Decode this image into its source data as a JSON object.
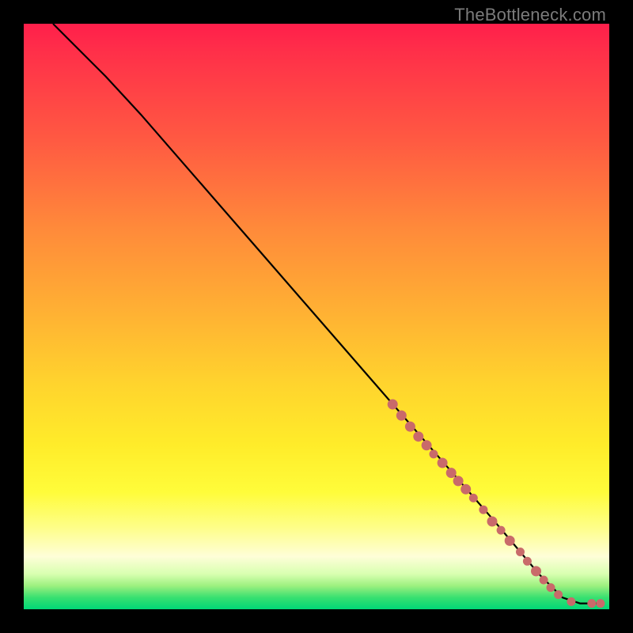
{
  "watermark": "TheBottleneck.com",
  "colors": {
    "curve": "#000000",
    "point_fill": "#c96a6a",
    "point_stroke": "#c96a6a"
  },
  "chart_data": {
    "type": "line",
    "title": "",
    "xlabel": "",
    "ylabel": "",
    "xlim": [
      0,
      100
    ],
    "ylim": [
      0,
      100
    ],
    "curve": [
      {
        "x": 5,
        "y": 100
      },
      {
        "x": 9,
        "y": 96
      },
      {
        "x": 14,
        "y": 91
      },
      {
        "x": 20,
        "y": 84.5
      },
      {
        "x": 30,
        "y": 73
      },
      {
        "x": 40,
        "y": 61.5
      },
      {
        "x": 50,
        "y": 50
      },
      {
        "x": 60,
        "y": 38.5
      },
      {
        "x": 70,
        "y": 27
      },
      {
        "x": 80,
        "y": 15.5
      },
      {
        "x": 88,
        "y": 6
      },
      {
        "x": 92,
        "y": 2
      },
      {
        "x": 95,
        "y": 1
      },
      {
        "x": 98,
        "y": 1
      }
    ],
    "points": [
      {
        "x": 63.0,
        "y": 35.0,
        "r": 6
      },
      {
        "x": 64.5,
        "y": 33.1,
        "r": 6
      },
      {
        "x": 66.0,
        "y": 31.2,
        "r": 6
      },
      {
        "x": 67.4,
        "y": 29.5,
        "r": 6
      },
      {
        "x": 68.8,
        "y": 28.0,
        "r": 6
      },
      {
        "x": 70.0,
        "y": 26.5,
        "r": 5
      },
      {
        "x": 71.5,
        "y": 25.0,
        "r": 6
      },
      {
        "x": 73.0,
        "y": 23.3,
        "r": 6
      },
      {
        "x": 74.2,
        "y": 21.9,
        "r": 6
      },
      {
        "x": 75.5,
        "y": 20.5,
        "r": 6
      },
      {
        "x": 76.8,
        "y": 19.0,
        "r": 5
      },
      {
        "x": 78.5,
        "y": 17.0,
        "r": 5
      },
      {
        "x": 80.0,
        "y": 15.0,
        "r": 6
      },
      {
        "x": 81.5,
        "y": 13.5,
        "r": 5
      },
      {
        "x": 83.0,
        "y": 11.7,
        "r": 6
      },
      {
        "x": 84.8,
        "y": 9.8,
        "r": 5
      },
      {
        "x": 86.0,
        "y": 8.2,
        "r": 5
      },
      {
        "x": 87.5,
        "y": 6.5,
        "r": 6
      },
      {
        "x": 88.8,
        "y": 5.0,
        "r": 5
      },
      {
        "x": 90.0,
        "y": 3.7,
        "r": 5
      },
      {
        "x": 91.3,
        "y": 2.5,
        "r": 5
      },
      {
        "x": 93.5,
        "y": 1.3,
        "r": 5
      },
      {
        "x": 97.0,
        "y": 1.0,
        "r": 5
      },
      {
        "x": 98.5,
        "y": 1.0,
        "r": 5
      }
    ]
  }
}
